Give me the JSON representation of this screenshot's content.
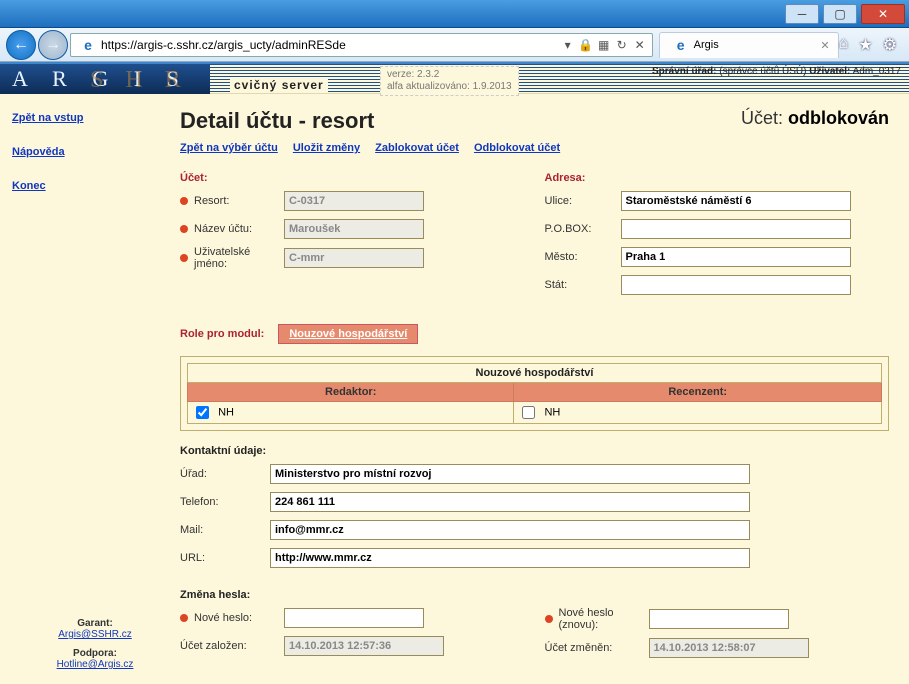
{
  "window": {
    "url": "https://argis-c.sshr.cz/argis_ucty/adminRESde",
    "tab_title": "Argis"
  },
  "banner": {
    "logo": "A R G I S",
    "shadow": "S H R",
    "subtitle": "cvičný server",
    "version_line1": "verze: 2.3.2",
    "version_line2": "alfa aktualizováno: 1.9.2013",
    "meta_admin_label": "Správní úřad:",
    "meta_admin_value": "(správce účtů ÚSÚ)",
    "meta_user_label": "Uživatel:",
    "meta_user_value": "Adm_0317"
  },
  "sidebar": {
    "back": "Zpět na vstup",
    "help": "Nápověda",
    "end": "Konec",
    "garant_label": "Garant:",
    "garant_link": "Argis@SSHR.cz",
    "support_label": "Podpora:",
    "support_link": "Hotline@Argis.cz"
  },
  "header": {
    "title": "Detail účtu - resort",
    "status_label": "Účet:",
    "status_value": "odblokován"
  },
  "actions": {
    "back": "Zpět na výběr účtu",
    "save": "Uložit změny",
    "block": "Zablokovat účet",
    "unblock": "Odblokovat účet"
  },
  "account": {
    "section": "Účet:",
    "resort_label": "Resort:",
    "resort_value": "C-0317",
    "name_label": "Název účtu:",
    "name_value": "Maroušek",
    "username_label": "Uživatelské jméno:",
    "username_value": "C-mmr"
  },
  "address": {
    "section": "Adresa:",
    "street_label": "Ulice:",
    "street_value": "Staroměstské náměstí 6",
    "pobox_label": "P.O.BOX:",
    "pobox_value": "",
    "city_label": "Město:",
    "city_value": "Praha 1",
    "state_label": "Stát:",
    "state_value": ""
  },
  "roles": {
    "label": "Role pro modul:",
    "button": "Nouzové hospodářství",
    "caption": "Nouzové hospodářství",
    "col_editor": "Redaktor:",
    "col_reviewer": "Recenzent:",
    "row_editor_label": "NH",
    "row_editor_checked": true,
    "row_reviewer_label": "NH",
    "row_reviewer_checked": false
  },
  "contact": {
    "section": "Kontaktní údaje:",
    "office_label": "Úřad:",
    "office_value": "Ministerstvo pro místní rozvoj",
    "phone_label": "Telefon:",
    "phone_value": "224 861 111",
    "mail_label": "Mail:",
    "mail_value": "info@mmr.cz",
    "url_label": "URL:",
    "url_value": "http://www.mmr.cz"
  },
  "password": {
    "section": "Změna hesla:",
    "new_label": "Nové heslo:",
    "new_value": "",
    "again_label": "Nové heslo (znovu):",
    "again_value": ""
  },
  "audit": {
    "created_label": "Účet založen:",
    "created_value": "14.10.2013 12:57:36",
    "changed_label": "Účet změněn:",
    "changed_value": "14.10.2013 12:58:07"
  }
}
